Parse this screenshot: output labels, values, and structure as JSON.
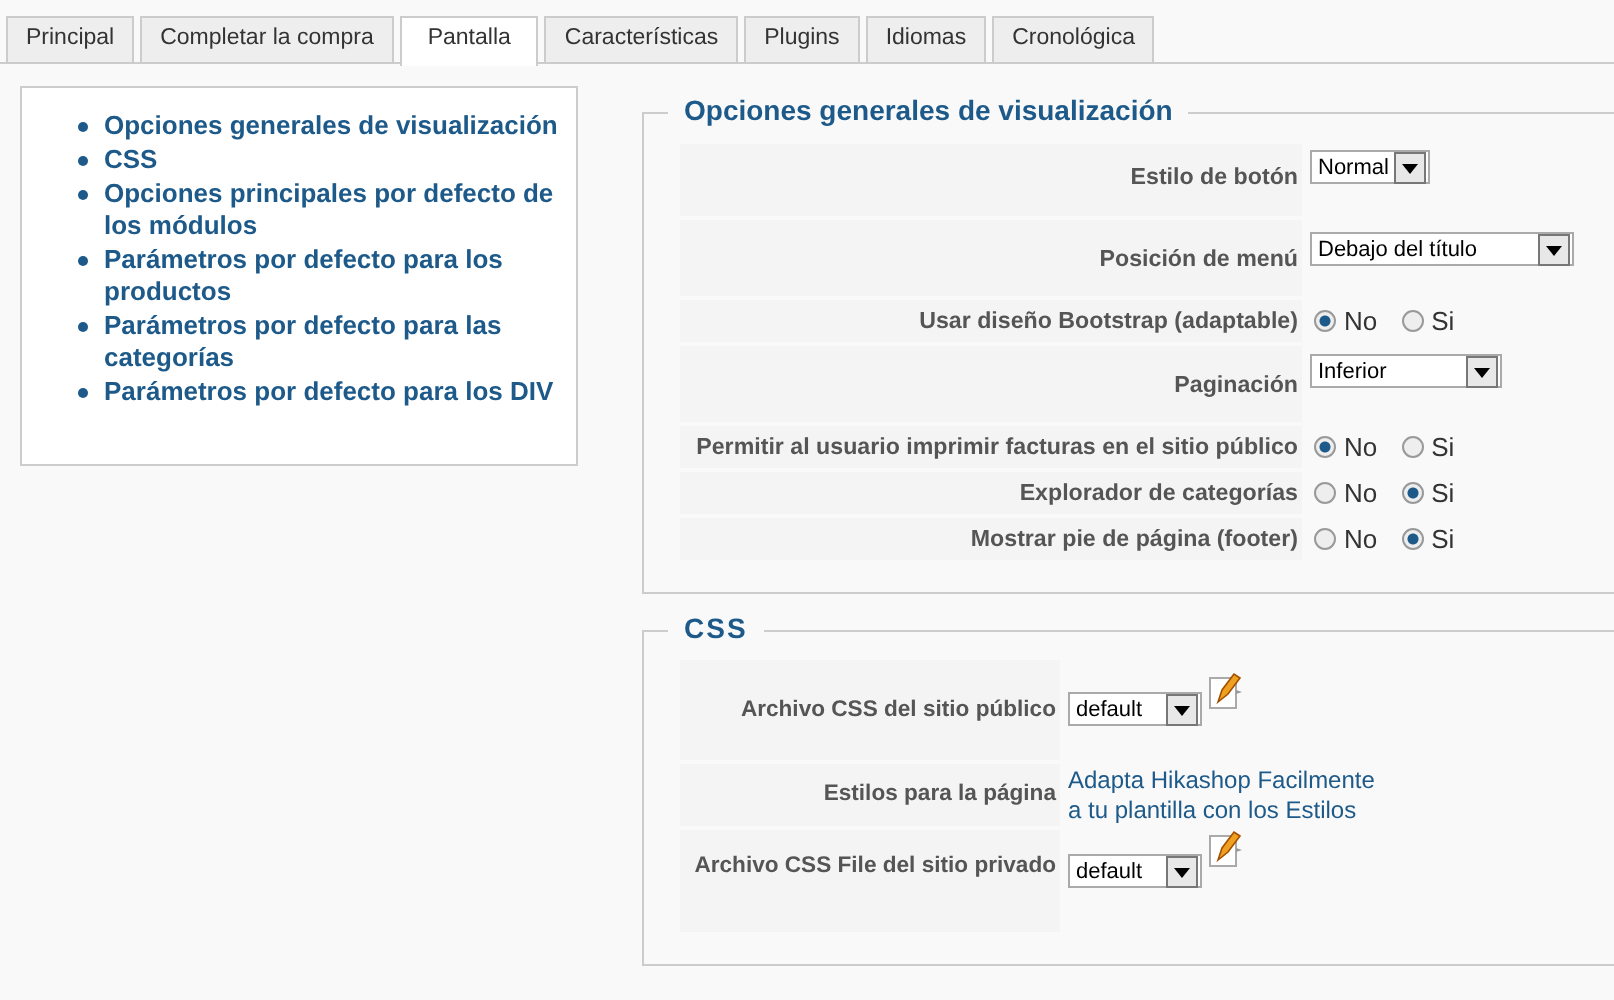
{
  "tabs": [
    {
      "label": "Principal",
      "selected": false
    },
    {
      "label": "Completar la compra",
      "selected": false
    },
    {
      "label": "Pantalla",
      "selected": true
    },
    {
      "label": "Características",
      "selected": false
    },
    {
      "label": "Plugins",
      "selected": false
    },
    {
      "label": "Idiomas",
      "selected": false
    },
    {
      "label": "Cronológica",
      "selected": false
    }
  ],
  "sidebar": {
    "items": [
      "Opciones generales de visualización",
      "CSS",
      "Opciones principales por defecto de los módulos",
      "Parámetros por defecto para los productos",
      "Parámetros por defecto para las categorías",
      "Parámetros por defecto para los DIV"
    ]
  },
  "sections": [
    {
      "title": "Opciones generales de visualización",
      "rows": [
        {
          "kind": "select",
          "label": "Estilo de botón",
          "value": "Normal"
        },
        {
          "kind": "select",
          "label": "Posición de menú",
          "value": "Debajo del título"
        },
        {
          "kind": "radio",
          "label": "Usar diseño Bootstrap (adaptable)",
          "options": [
            {
              "label": "No",
              "selected": true
            },
            {
              "label": "Si",
              "selected": false
            }
          ]
        },
        {
          "kind": "select",
          "label": "Paginación",
          "value": "Inferior"
        },
        {
          "kind": "radio",
          "label": "Permitir al usuario imprimir facturas en el sitio público",
          "options": [
            {
              "label": "No",
              "selected": true
            },
            {
              "label": "Si",
              "selected": false
            }
          ]
        },
        {
          "kind": "radio",
          "label": "Explorador de categorías",
          "options": [
            {
              "label": "No",
              "selected": false
            },
            {
              "label": "Si",
              "selected": true
            }
          ]
        },
        {
          "kind": "radio",
          "label": "Mostrar pie de página (footer)",
          "options": [
            {
              "label": "No",
              "selected": false
            },
            {
              "label": "Si",
              "selected": true
            }
          ]
        }
      ]
    },
    {
      "title": "CSS",
      "rows": [
        {
          "kind": "select_edit",
          "label": "Archivo CSS del sitio público",
          "value": "default"
        },
        {
          "kind": "link",
          "label": "Estilos para la página",
          "text": "Adapta Hikashop Facilmente a tu plantilla con los Estilos"
        },
        {
          "kind": "select_edit",
          "label": "Archivo CSS File del sitio privado",
          "value": "default"
        }
      ]
    }
  ]
}
